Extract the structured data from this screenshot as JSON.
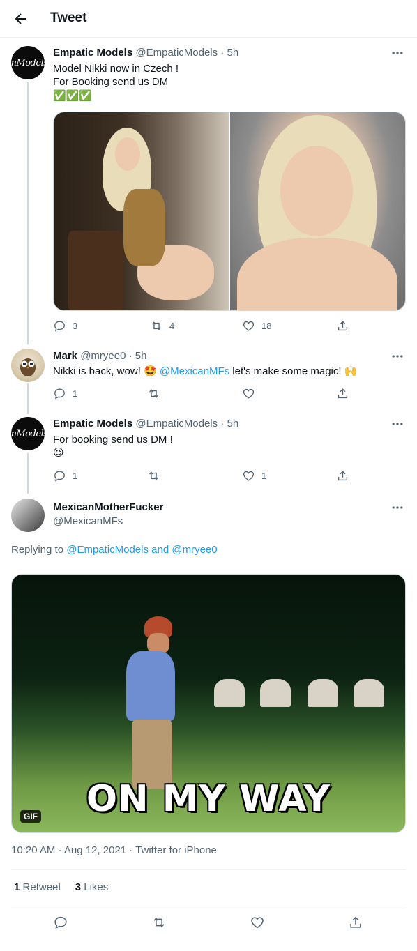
{
  "header": {
    "title": "Tweet"
  },
  "tweets": [
    {
      "name": "Empatic Models",
      "handle": "@EmpaticModels · 5h",
      "avatar_text": "mModels",
      "lines": [
        "Model Nikki now in Czech !",
        "For Booking send us DM"
      ],
      "emoji": "✅✅✅",
      "replies": "3",
      "retweets": "4",
      "likes": "18"
    },
    {
      "name": "Mark",
      "handle": "@mryee0 · 5h",
      "text_before": "Nikki is back, wow! 🤩 ",
      "mention": "@MexicanMFs",
      "text_after": " let's make some magic! 🙌",
      "replies": "1",
      "retweets": "",
      "likes": ""
    },
    {
      "name": "Empatic Models",
      "handle": "@EmpaticModels · 5h",
      "avatar_text": "mModels",
      "lines": [
        "For booking send us DM !"
      ],
      "emoji": "😉",
      "replies": "1",
      "retweets": "",
      "likes": "1"
    }
  ],
  "main": {
    "name": "MexicanMotherFucker",
    "handle": "@MexicanMFs",
    "replying_prefix": "Replying to ",
    "replying_users": "@EmpaticModels and @mryee0",
    "gif_caption": "ON MY WAY",
    "gif_badge": "GIF",
    "meta": "10:20 AM · Aug 12, 2021 · Twitter for iPhone",
    "retweet_count": "1",
    "retweet_label": "Retweet",
    "like_count": "3",
    "like_label": "Likes"
  },
  "colors": {
    "accent": "#1d9bf0",
    "text": "#0f1419",
    "muted": "#536471",
    "border": "#cfd9de"
  }
}
